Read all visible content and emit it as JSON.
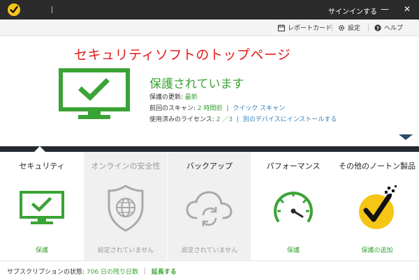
{
  "titlebar": {
    "signin_label": "サインインする",
    "minimize_glyph": "—",
    "close_glyph": "✕"
  },
  "toolbar": {
    "report_card_label": "レポートカード",
    "settings_label": "設定",
    "help_label": "ヘルプ"
  },
  "hero": {
    "headline": "セキュリティソフトのトップページ",
    "status_title": "保護されています",
    "update_label": "保護の更新:",
    "update_value": "最新",
    "scan_label": "前回のスキャン:",
    "scan_value": "2 時間前",
    "quick_scan_link": "クイック スキャン",
    "license_label": "使用済みのライセンス:",
    "license_value": "2 ／3",
    "install_link": "別のデバイスにインストールする",
    "link_separator": "|"
  },
  "tiles": [
    {
      "title": "セキュリティ",
      "status": "保護",
      "icon": "monitor-check-icon"
    },
    {
      "title": "オンラインの安全性",
      "status": "設定されていません",
      "icon": "shield-globe-icon"
    },
    {
      "title": "バックアップ",
      "status": "設定されていません",
      "icon": "cloud-sync-icon"
    },
    {
      "title": "パフォーマンス",
      "status": "保護",
      "icon": "speedometer-icon"
    },
    {
      "title": "その他のノートン製品",
      "status": "保護の追加",
      "icon": "norton-check-icon"
    }
  ],
  "footer": {
    "subscription_label": "サブスクリプションの状態:",
    "days_value": "706 日の残り日数",
    "renew_label": "延長する"
  },
  "colors": {
    "brand_green": "#3aa335",
    "link_blue": "#2d7fc0",
    "headline_red": "#e21b1b",
    "dark_bar": "#242a30",
    "norton_yellow": "#f5c518"
  }
}
